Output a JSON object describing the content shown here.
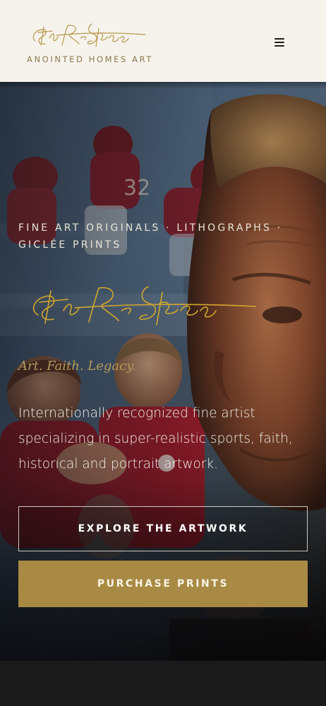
{
  "header": {
    "brand_name": "ANOINTED HOMES ART",
    "signature_logo": "Steve R Skipper",
    "menu_icon": "hamburger-menu-icon",
    "background": "#f6f3ec"
  },
  "hero": {
    "eyebrow": "FINE ART ORIGINALS · LITHOGRAPHS · GICLÉE PRINTS",
    "signature_logo": "Steve R Skipper",
    "tagline": "Art. Faith. Legacy.",
    "description": "Internationally recognized fine artist specializing in super-realistic sports, faith, historical and portrait artwork.",
    "primary_button": "EXPLORE THE ARTWORK",
    "secondary_button": "PURCHASE PRINTS"
  },
  "colors": {
    "gold_accent": "#a88a45",
    "tagline_gold": "#b29a5a",
    "header_brand": "#8b7a4e",
    "dark_background": "#1c1b1b"
  }
}
